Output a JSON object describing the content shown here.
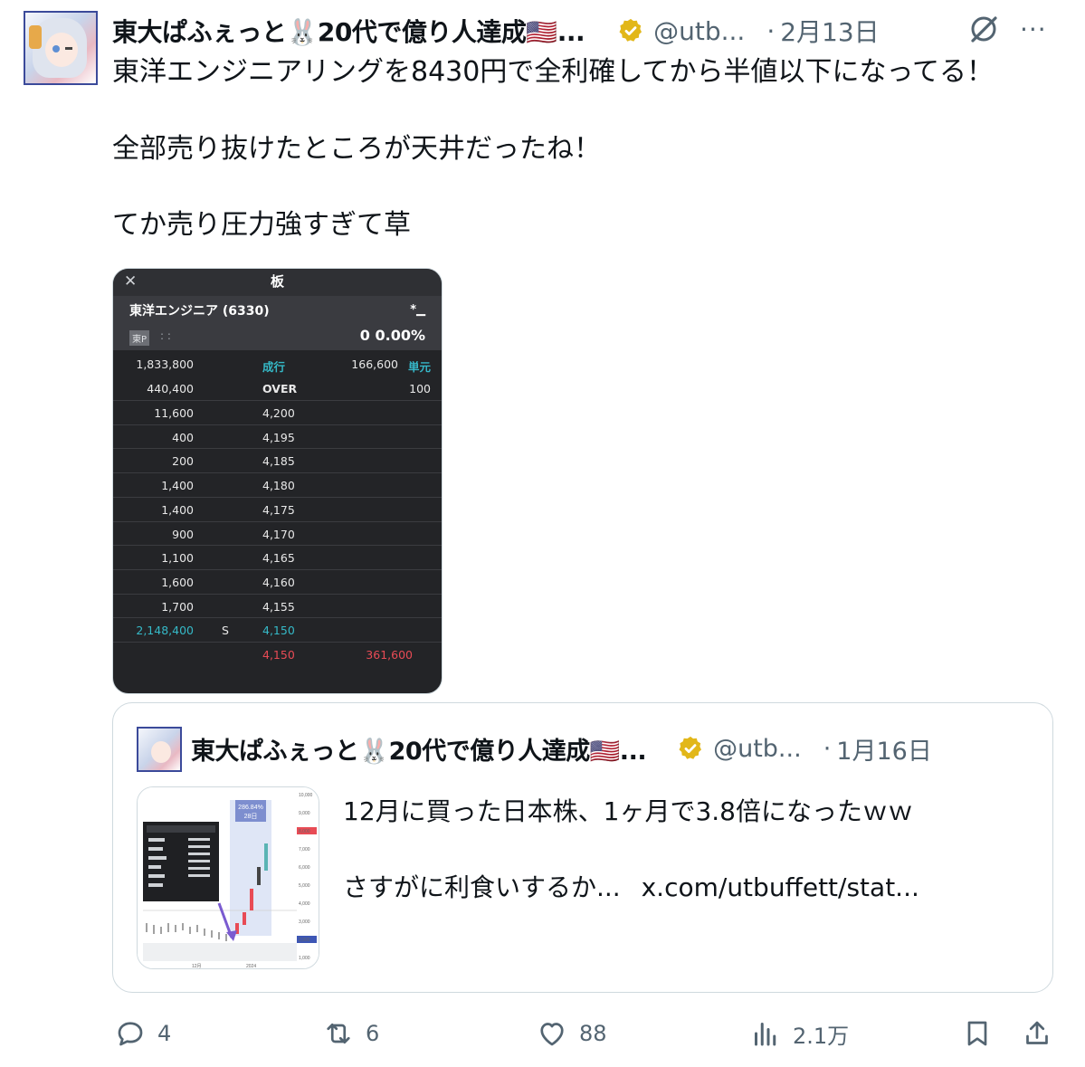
{
  "post": {
    "author_name": "東大ぱふぇっと🐰20代で億り人達成🇺🇸...",
    "handle": "@utb...",
    "date_sep": "·",
    "date": "2月13日",
    "more": "···",
    "text_lines": [
      "東洋エンジニアリングを8430円で全利確してから半値以下になってる！",
      "全部売り抜けたところが天井だったね！",
      "てか売り圧力強すぎて草"
    ]
  },
  "media": {
    "title": "板",
    "close": "✕",
    "stock_name": "東洋エンジニア (6330)",
    "stock_icon": "*▁",
    "market": "東P",
    "dots": ": :",
    "price_change": "0  0.00%",
    "rows": [
      {
        "qty": "1,833,800",
        "price": "成行",
        "sell": "166,600",
        "unit": "単元"
      },
      {
        "qty": "440,400",
        "price": "OVER",
        "sell": "100",
        "unit": ""
      },
      {
        "qty": "11,600",
        "price": "4,200",
        "sell": "",
        "unit": ""
      },
      {
        "qty": "400",
        "price": "4,195",
        "sell": "",
        "unit": ""
      },
      {
        "qty": "200",
        "price": "4,185",
        "sell": "",
        "unit": ""
      },
      {
        "qty": "1,400",
        "price": "4,180",
        "sell": "",
        "unit": ""
      },
      {
        "qty": "1,400",
        "price": "4,175",
        "sell": "",
        "unit": ""
      },
      {
        "qty": "900",
        "price": "4,170",
        "sell": "",
        "unit": ""
      },
      {
        "qty": "1,100",
        "price": "4,165",
        "sell": "",
        "unit": ""
      },
      {
        "qty": "1,600",
        "price": "4,160",
        "sell": "",
        "unit": ""
      },
      {
        "qty": "1,700",
        "price": "4,155",
        "sell": "",
        "unit": ""
      },
      {
        "qty": "2,148,400",
        "s": "S",
        "price": "4,150",
        "sell": "",
        "unit": ""
      },
      {
        "qty": "",
        "price": "4,150",
        "sell": "361,600",
        "unit": ""
      }
    ]
  },
  "quote": {
    "author_name": "東大ぱふぇっと🐰20代で億り人達成🇺🇸...",
    "handle": "@utb...",
    "date_sep": "·",
    "date": "1月16日",
    "line1": "12月に買った日本株、1ヶ月で3.8倍になったｗｗ",
    "line2_text": "さすがに利食いするか...",
    "line2_link": "x.com/utbuffett/stat...",
    "thumb_badge_1": "286.84%",
    "thumb_badge_2": "28日",
    "thumb_axis": [
      "10,000",
      "9,000",
      "8,000",
      "7,000",
      "6,000",
      "5,000",
      "4,000",
      "3,000",
      "2,000",
      "1,000"
    ],
    "thumb_x": [
      "12月",
      "2024"
    ]
  },
  "actions": {
    "replies": "4",
    "reposts": "6",
    "likes": "88",
    "views": "2.1万"
  }
}
